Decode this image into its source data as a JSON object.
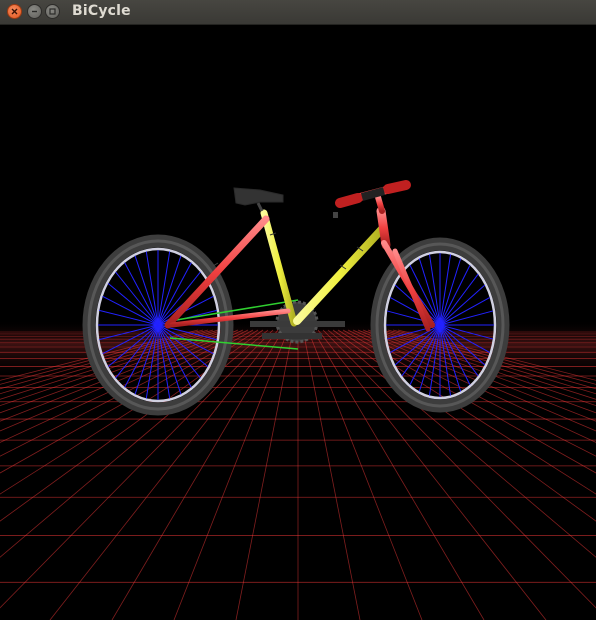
{
  "window": {
    "title": "BiCycle",
    "controls": [
      "close",
      "minimize",
      "maximize"
    ]
  },
  "scene": {
    "background": "#000000",
    "floor_grid_color": "#ff3b3b",
    "horizon_glow_color": "#5a1a1a",
    "frame_color_red": "#ff4a4a",
    "frame_color_yellow": "#f4f44a",
    "spoke_color": "#2222ff",
    "chain_color": "#2fd02f",
    "tire_color": "#3a3a3a",
    "rim_color": "#c8c8d8",
    "saddle_color": "#303030",
    "grip_color": "#e03030"
  }
}
